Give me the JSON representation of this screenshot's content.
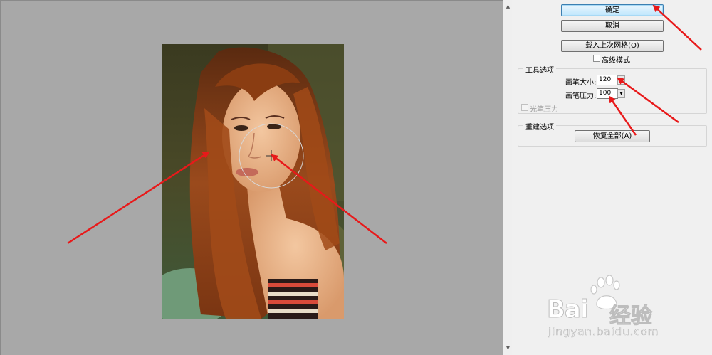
{
  "panel": {
    "ok_label": "确定",
    "cancel_label": "取消",
    "load_mesh_label": "载入上次网格(O)",
    "advanced_mode_label": "高级模式",
    "tool_options": {
      "title": "工具选项",
      "brush_size_label": "画笔大小:",
      "brush_size_value": "120",
      "brush_pressure_label": "画笔压力:",
      "brush_pressure_value": "100",
      "stylus_pressure_label": "光笔压力"
    },
    "rebuild_options": {
      "title": "重建选项",
      "restore_all_label": "恢复全部(A)"
    }
  },
  "watermark": {
    "brand": "Bai",
    "brand_suffix": "经验",
    "url": "jingyan.baidu.com"
  },
  "colors": {
    "canvas_bg": "#a8a8a8",
    "panel_bg": "#f0f0f0",
    "annotation_arrow": "#e8191a",
    "hair": "#8a3d12"
  },
  "icons": {
    "scroll_up": "up-arrow",
    "scroll_down": "down-arrow",
    "dropdown": "dropdown-arrow",
    "brush_cursor": "crosshair"
  }
}
